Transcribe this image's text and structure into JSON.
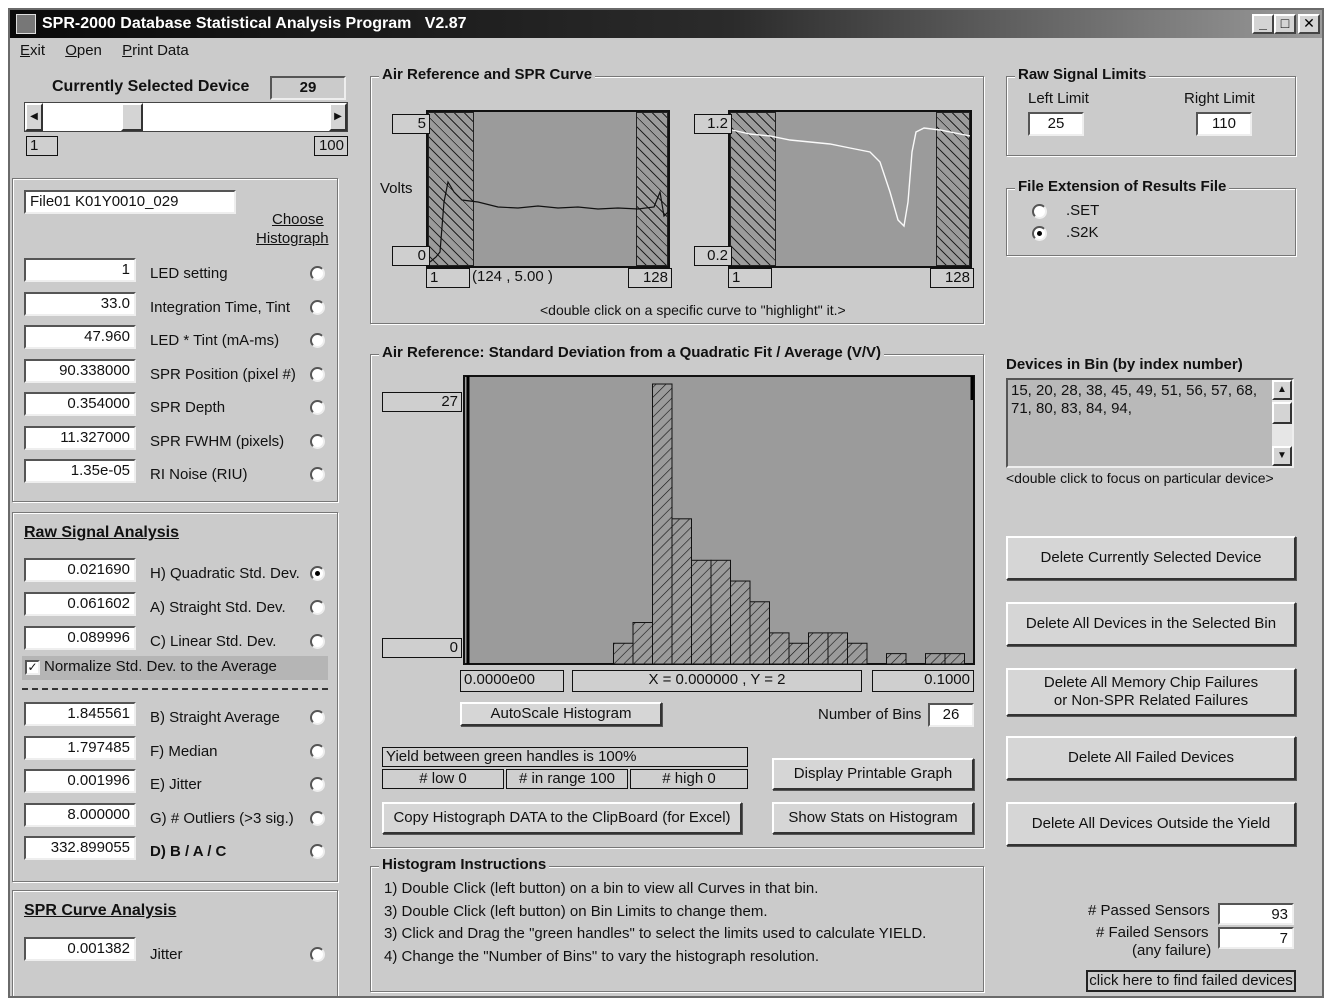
{
  "window": {
    "title": "SPR-2000 Database Statistical Analysis Program   V2.87"
  },
  "menu": {
    "items": [
      "Exit",
      "Open",
      "Print Data"
    ]
  },
  "device": {
    "label": "Currently Selected Device",
    "value": "29",
    "slider_min": "1",
    "slider_max": "100",
    "slider_fraction": 0.29
  },
  "file": {
    "name": "File01 K01Y0010_029",
    "choose_histograph": [
      "Choose",
      "Histograph"
    ]
  },
  "params": [
    {
      "value": "1",
      "label": "LED setting",
      "selected": false
    },
    {
      "value": "33.0",
      "label": "Integration Time, Tint",
      "selected": false
    },
    {
      "value": "47.960",
      "label": "LED * Tint (mA-ms)",
      "selected": false
    },
    {
      "value": "90.338000",
      "label": "SPR Position (pixel #)",
      "selected": false
    },
    {
      "value": "0.354000",
      "label": "SPR Depth",
      "selected": false
    },
    {
      "value": "11.327000",
      "label": "SPR FWHM (pixels)",
      "selected": false
    },
    {
      "value": "1.35e-05",
      "label": "RI Noise (RIU)",
      "selected": false
    }
  ],
  "raw_signal": {
    "heading": "Raw Signal Analysis",
    "items": [
      {
        "value": "0.021690",
        "label": "H) Quadratic Std. Dev.",
        "selected": true
      },
      {
        "value": "0.061602",
        "label": "A) Straight Std. Dev.",
        "selected": false
      },
      {
        "value": "0.089996",
        "label": "C) Linear Std. Dev.",
        "selected": false
      }
    ],
    "normalize_label": "Normalize Std. Dev. to the Average",
    "normalize_checked": true,
    "items2": [
      {
        "value": "1.845561",
        "label": "B) Straight Average",
        "selected": false
      },
      {
        "value": "1.797485",
        "label": "F) Median",
        "selected": false
      },
      {
        "value": "0.001996",
        "label": "E) Jitter",
        "selected": false
      },
      {
        "value": "8.000000",
        "label": "G) # Outliers (>3 sig.)",
        "selected": false
      },
      {
        "value": "332.899055",
        "label": "D)   B / A / C",
        "selected": false
      }
    ]
  },
  "spr_curve": {
    "heading": "SPR Curve Analysis",
    "value": "0.001382",
    "label": "Jitter"
  },
  "air_ref": {
    "title": "Air Reference  and SPR Curve",
    "left_plot": {
      "y_max": "5",
      "y_min": "0",
      "x_min": "1",
      "x_max": "128",
      "ylabel": "Volts",
      "cursor": "(124 , 5.00 )"
    },
    "right_plot": {
      "y_max": "1.2",
      "y_min": "0.2",
      "x_min": "1",
      "x_max": "128"
    },
    "hint": "<double click on a specific curve to \"highlight\" it.>"
  },
  "histogram": {
    "title": "Air Reference: Standard Deviation from a Quadratic Fit / Average (V/V)",
    "y_max": "27",
    "y_min": "0",
    "x_min": "0.0000e00",
    "x_max": "0.1000",
    "cursor": "X = 0.000000 , Y = 2",
    "autoscale_label": "AutoScale Histogram",
    "bins_label": "Number of Bins",
    "bins_value": "26",
    "yield_text": "Yield between green handles is 100%",
    "low": "# low 0",
    "in_range": "# in range 100",
    "high": "# high 0",
    "display_btn": "Display Printable Graph",
    "copy_btn": "Copy Histograph DATA to the ClipBoard (for Excel)",
    "stats_btn": "Show Stats on Histogram"
  },
  "chart_data": {
    "type": "bar",
    "title": "Air Reference: Standard Deviation from a Quadratic Fit / Average (V/V)",
    "xlabel": "",
    "ylabel": "",
    "xlim": [
      0,
      0.1
    ],
    "ylim": [
      0,
      27
    ],
    "categories": [
      "1",
      "2",
      "3",
      "4",
      "5",
      "6",
      "7",
      "8",
      "9",
      "10",
      "11",
      "12",
      "13",
      "14",
      "15",
      "16",
      "17",
      "18",
      "19",
      "20",
      "21",
      "22",
      "23",
      "24",
      "25",
      "26"
    ],
    "values": [
      0,
      0,
      0,
      0,
      0,
      2,
      4,
      27,
      14,
      10,
      10,
      8,
      6,
      3,
      2,
      3,
      3,
      2,
      0,
      1,
      0,
      1,
      1,
      0,
      1,
      0
    ]
  },
  "instructions": {
    "title": "Histogram Instructions",
    "lines": [
      "1)  Double Click (left button) on a bin to view all Curves in that bin.",
      "3)  Double Click (left button) on Bin Limits to change them.",
      "3)  Click and Drag the \"green handles\" to select the limits used to calculate YIELD.",
      "4)  Change the \"Number of Bins\" to vary the histograph resolution."
    ]
  },
  "raw_limits": {
    "title": "Raw Signal Limits",
    "left_label": "Left Limit",
    "right_label": "Right Limit",
    "left_value": "25",
    "right_value": "110"
  },
  "file_ext": {
    "title": "File Extension of Results File",
    "options": [
      {
        "label": ".SET",
        "selected": false
      },
      {
        "label": ".S2K",
        "selected": true
      }
    ]
  },
  "devices_in_bin": {
    "title": "Devices in Bin (by index number)",
    "list": "15, 20, 28, 38, 45, 49, 51, 56, 57, 68, 71, 80, 83, 84, 94,",
    "hint": "<double click to focus on particular device>"
  },
  "delete_buttons": [
    "Delete Currently Selected Device",
    "Delete All Devices in the Selected Bin",
    "Delete All Memory Chip Failures\nor Non-SPR Related Failures",
    "Delete All Failed Devices",
    "Delete All Devices Outside the Yield"
  ],
  "sensors": {
    "passed_label": "# Passed Sensors",
    "passed_value": "93",
    "failed_label": "# Failed Sensors",
    "failed_sub": "(any failure)",
    "failed_value": "7",
    "find_btn": "click here to find failed devices"
  }
}
